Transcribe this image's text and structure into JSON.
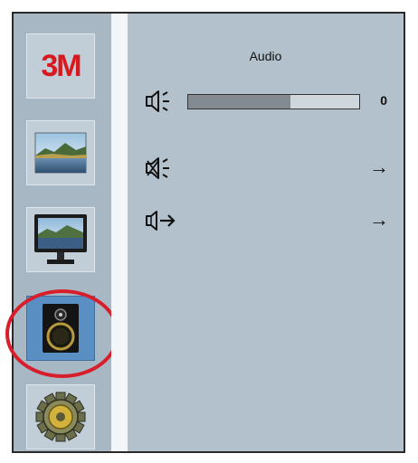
{
  "brand": {
    "logo_text": "3M"
  },
  "sidebar": {
    "items": [
      {
        "name": "brand-logo"
      },
      {
        "name": "picture-icon"
      },
      {
        "name": "monitor-icon"
      },
      {
        "name": "speaker-icon",
        "selected": true
      },
      {
        "name": "gear-icon"
      }
    ]
  },
  "menu": {
    "title": "Audio",
    "rows": [
      {
        "icon": "volume-icon",
        "type": "slider",
        "value_text": "0",
        "level": 0.6
      },
      {
        "icon": "mute-icon",
        "type": "arrow",
        "arrow": "→"
      },
      {
        "icon": "audio-input-icon",
        "type": "arrow",
        "arrow": "→"
      }
    ]
  },
  "colors": {
    "highlight_ring": "#d81e2b",
    "logo": "#d7191f",
    "panel_bg": "#b2c1cc"
  }
}
